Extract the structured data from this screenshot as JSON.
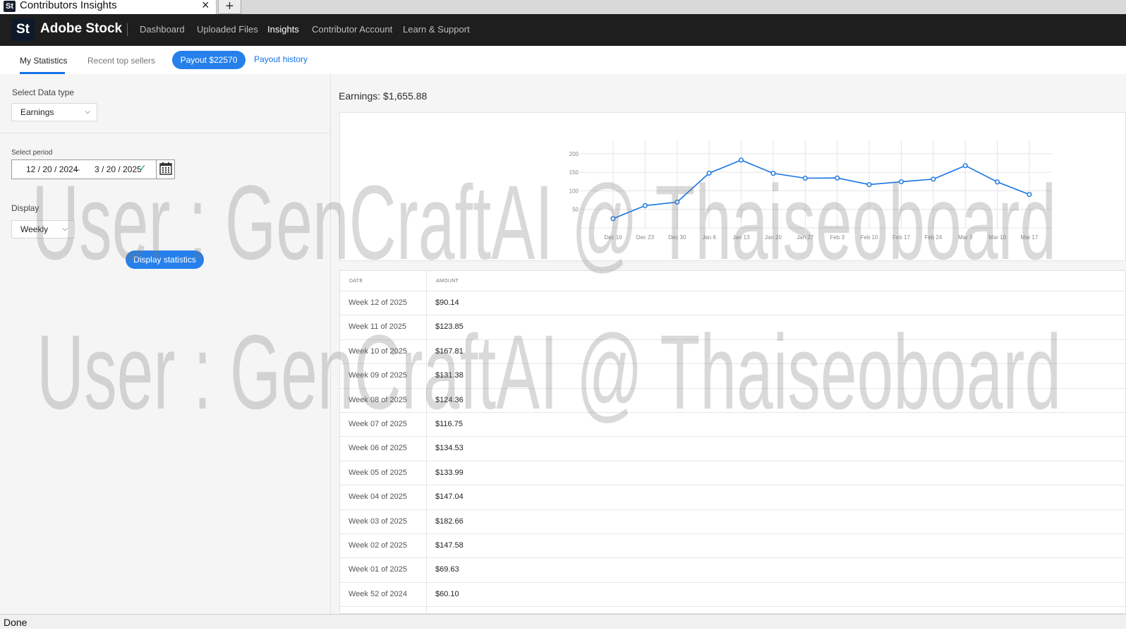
{
  "browser": {
    "tab_title": "Contributors Insights",
    "tab_logo": "St",
    "close_icon": "×",
    "new_tab_icon": "+",
    "status": "Done"
  },
  "topnav": {
    "logo": "St",
    "brand": "Adobe Stock",
    "items": [
      "Dashboard",
      "Uploaded Files",
      "Insights",
      "Contributor Account",
      "Learn & Support"
    ],
    "active": "Insights"
  },
  "subnav": {
    "tabs": [
      "My Statistics",
      "Recent top sellers"
    ],
    "active": "My Statistics",
    "payout_button": "Payout $22570",
    "payout_history": "Payout history"
  },
  "filters": {
    "data_type_label": "Select Data type",
    "data_type_value": "Earnings",
    "period_label": "Select period",
    "date_from": "12 / 20 / 2024",
    "date_separator": "–",
    "date_to": "3 / 20 / 2025",
    "display_label": "Display",
    "display_value": "Weekly",
    "display_button": "Display statistics"
  },
  "earnings_title": "Earnings: $1,655.88",
  "chart_data": {
    "type": "line",
    "x": [
      "Dec 16",
      "Dec 23",
      "Dec 30",
      "Jan 6",
      "Jan 13",
      "Jan 20",
      "Jan 27",
      "Feb 3",
      "Feb 10",
      "Feb 17",
      "Feb 24",
      "Mar 3",
      "Mar 10",
      "Mar 17"
    ],
    "series": [
      {
        "values": [
          25,
          60,
          69.63,
          147.58,
          182.66,
          147.04,
          133.99,
          134.53,
          116.75,
          124.36,
          131.38,
          167.81,
          123.85,
          90.14
        ]
      }
    ],
    "yticks": [
      50,
      100,
      150,
      200
    ],
    "ylim": [
      0,
      230
    ],
    "grid": true,
    "color": "#1473e6"
  },
  "table": {
    "headers": [
      "DATE",
      "AMOUNT"
    ],
    "rows": [
      {
        "date": "Week 12 of 2025",
        "amount": "$90.14"
      },
      {
        "date": "Week 11 of 2025",
        "amount": "$123.85"
      },
      {
        "date": "Week 10 of 2025",
        "amount": "$167.81"
      },
      {
        "date": "Week 09 of 2025",
        "amount": "$131.38"
      },
      {
        "date": "Week 08 of 2025",
        "amount": "$124.36"
      },
      {
        "date": "Week 07 of 2025",
        "amount": "$116.75"
      },
      {
        "date": "Week 06 of 2025",
        "amount": "$134.53"
      },
      {
        "date": "Week 05 of 2025",
        "amount": "$133.99"
      },
      {
        "date": "Week 04 of 2025",
        "amount": "$147.04"
      },
      {
        "date": "Week 03 of 2025",
        "amount": "$182.66"
      },
      {
        "date": "Week 02 of 2025",
        "amount": "$147.58"
      },
      {
        "date": "Week 01 of 2025",
        "amount": "$69.63"
      },
      {
        "date": "Week 52 of 2024",
        "amount": "$60.10"
      }
    ]
  },
  "watermark": "User : GenCraftAI @ Thaiseoboard",
  "icons": {
    "chevron": "chevron-down-icon",
    "check": "check-icon",
    "calendar": "calendar-icon"
  }
}
